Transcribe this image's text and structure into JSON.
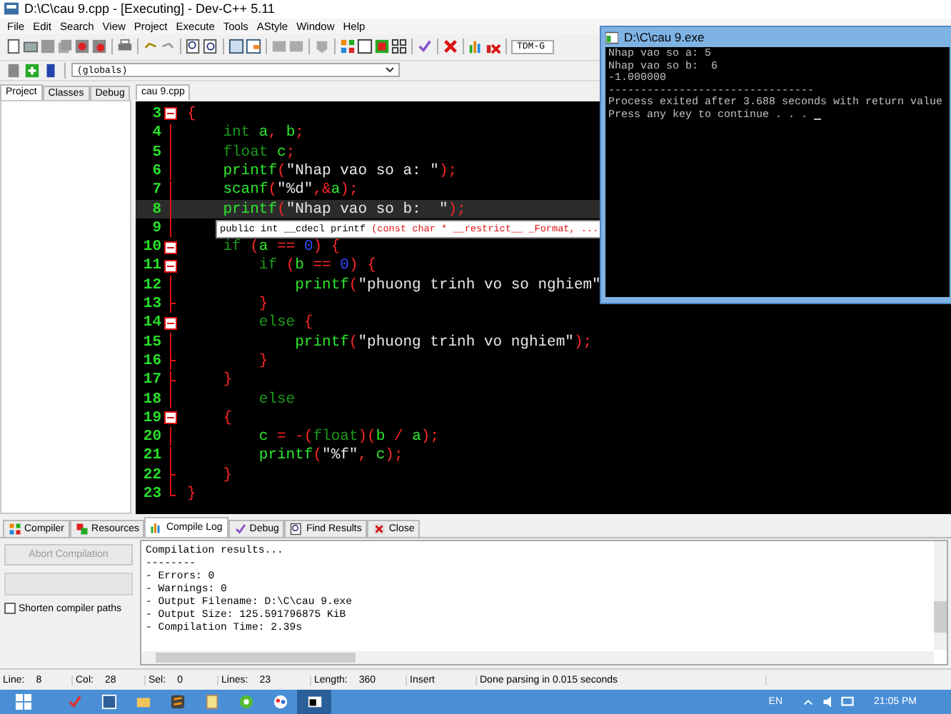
{
  "window": {
    "title": "D:\\C\\cau 9.cpp - [Executing] - Dev-C++ 5.11"
  },
  "menu": [
    "File",
    "Edit",
    "Search",
    "View",
    "Project",
    "Execute",
    "Tools",
    "AStyle",
    "Window",
    "Help"
  ],
  "compiler_select": {
    "value": "TDM-G"
  },
  "scope_select": {
    "value": "(globals)"
  },
  "side_tabs": [
    {
      "label": "Project",
      "selected": true
    },
    {
      "label": "Classes",
      "selected": false
    },
    {
      "label": "Debug",
      "selected": false
    }
  ],
  "editor_tabs": [
    {
      "label": "cau 9.cpp",
      "selected": true
    }
  ],
  "code_lines": [
    {
      "number": "3",
      "kind": "start",
      "current": false,
      "tokens": [
        {
          "text": "{",
          "kind": "punct"
        }
      ]
    },
    {
      "number": "4",
      "kind": "none",
      "current": false,
      "tokens": [
        {
          "text": "    int",
          "kind": "keyword"
        },
        {
          "text": " a",
          "kind": "ident"
        },
        {
          "text": ",",
          "kind": "punct"
        },
        {
          "text": " b",
          "kind": "ident"
        },
        {
          "text": ";",
          "kind": "punct"
        }
      ]
    },
    {
      "number": "5",
      "kind": "none",
      "current": false,
      "tokens": [
        {
          "text": "    float",
          "kind": "keyword"
        },
        {
          "text": " c",
          "kind": "ident"
        },
        {
          "text": ";",
          "kind": "punct"
        }
      ]
    },
    {
      "number": "6",
      "kind": "none",
      "current": false,
      "tokens": [
        {
          "text": "    printf",
          "kind": "ident"
        },
        {
          "text": "(",
          "kind": "punct"
        },
        {
          "text": "\"Nhap vao so a: \"",
          "kind": "string"
        },
        {
          "text": ");",
          "kind": "punct"
        }
      ]
    },
    {
      "number": "7",
      "kind": "none",
      "current": false,
      "tokens": [
        {
          "text": "    scanf",
          "kind": "ident"
        },
        {
          "text": "(",
          "kind": "punct"
        },
        {
          "text": "\"%d\"",
          "kind": "string"
        },
        {
          "text": ",&",
          "kind": "punct"
        },
        {
          "text": "a",
          "kind": "ident"
        },
        {
          "text": ");",
          "kind": "punct"
        }
      ]
    },
    {
      "number": "8",
      "kind": "none",
      "current": true,
      "tokens": [
        {
          "text": "    printf",
          "kind": "ident"
        },
        {
          "text": "(",
          "kind": "punct"
        },
        {
          "text": "\"Nhap vao so b:  \"",
          "kind": "string"
        },
        {
          "text": ");",
          "kind": "punct"
        }
      ]
    },
    {
      "number": "9",
      "kind": "none",
      "current": false
    },
    {
      "number": "10",
      "kind": "start",
      "current": false,
      "tokens": [
        {
          "text": "    if",
          "kind": "keyword"
        },
        {
          "text": " (",
          "kind": "punct"
        },
        {
          "text": "a",
          "kind": "ident"
        },
        {
          "text": " == ",
          "kind": "punct"
        },
        {
          "text": "0",
          "kind": "number"
        },
        {
          "text": ") {",
          "kind": "punct"
        }
      ]
    },
    {
      "number": "11",
      "kind": "start",
      "current": false,
      "tokens": [
        {
          "text": "        if",
          "kind": "keyword"
        },
        {
          "text": " (",
          "kind": "punct"
        },
        {
          "text": "b",
          "kind": "ident"
        },
        {
          "text": " == ",
          "kind": "punct"
        },
        {
          "text": "0",
          "kind": "number"
        },
        {
          "text": ") {",
          "kind": "punct"
        }
      ]
    },
    {
      "number": "12",
      "kind": "none",
      "current": false,
      "tokens": [
        {
          "text": "            printf",
          "kind": "ident"
        },
        {
          "text": "(",
          "kind": "punct"
        },
        {
          "text": "\"phuong trinh vo so nghiem\"",
          "kind": "string"
        }
      ]
    },
    {
      "number": "13",
      "kind": "end",
      "current": false,
      "tokens": [
        {
          "text": "        }",
          "kind": "punct"
        }
      ]
    },
    {
      "number": "14",
      "kind": "start",
      "current": false,
      "tokens": [
        {
          "text": "        else",
          "kind": "keyword"
        },
        {
          "text": " {",
          "kind": "punct"
        }
      ]
    },
    {
      "number": "15",
      "kind": "none",
      "current": false,
      "tokens": [
        {
          "text": "            printf",
          "kind": "ident"
        },
        {
          "text": "(",
          "kind": "punct"
        },
        {
          "text": "\"phuong trinh vo nghiem\"",
          "kind": "string"
        },
        {
          "text": ");",
          "kind": "punct"
        }
      ]
    },
    {
      "number": "16",
      "kind": "end",
      "current": false,
      "tokens": [
        {
          "text": "        }",
          "kind": "punct"
        }
      ]
    },
    {
      "number": "17",
      "kind": "end",
      "current": false,
      "tokens": [
        {
          "text": "    }",
          "kind": "punct"
        }
      ]
    },
    {
      "number": "18",
      "kind": "none",
      "current": false,
      "tokens": [
        {
          "text": "        else",
          "kind": "keyword"
        }
      ]
    },
    {
      "number": "19",
      "kind": "start",
      "current": false,
      "tokens": [
        {
          "text": "    {",
          "kind": "punct"
        }
      ]
    },
    {
      "number": "20",
      "kind": "none",
      "current": false,
      "tokens": [
        {
          "text": "        c",
          "kind": "ident"
        },
        {
          "text": " = -(",
          "kind": "punct"
        },
        {
          "text": "float",
          "kind": "keyword"
        },
        {
          "text": ")(",
          "kind": "punct"
        },
        {
          "text": "b",
          "kind": "ident"
        },
        {
          "text": " / ",
          "kind": "punct"
        },
        {
          "text": "a",
          "kind": "ident"
        },
        {
          "text": ");",
          "kind": "punct"
        }
      ]
    },
    {
      "number": "21",
      "kind": "none",
      "current": false,
      "tokens": [
        {
          "text": "        printf",
          "kind": "ident"
        },
        {
          "text": "(",
          "kind": "punct"
        },
        {
          "text": "\"%f\"",
          "kind": "string"
        },
        {
          "text": ", ",
          "kind": "punct"
        },
        {
          "text": "c",
          "kind": "ident"
        },
        {
          "text": ");",
          "kind": "punct"
        }
      ]
    },
    {
      "number": "22",
      "kind": "end",
      "current": false,
      "tokens": [
        {
          "text": "    }",
          "kind": "punct"
        }
      ]
    },
    {
      "number": "23",
      "kind": "last",
      "current": false,
      "tokens": [
        {
          "text": "}",
          "kind": "punct"
        }
      ]
    }
  ],
  "tooltip": {
    "tokens": [
      {
        "text": "public int __cdecl printf ",
        "kind": "plain"
      },
      {
        "text": "(const char * __restrict__ _Format, ...",
        "kind": "param"
      }
    ]
  },
  "console": {
    "title": "D:\\C\\cau 9.exe",
    "lines": [
      "Nhap vao so a: 5",
      "Nhap vao so b:  6",
      "-1.000000",
      "--------------------------------",
      "Process exited after 3.688 seconds with return value",
      "Press any key to continue . . . "
    ]
  },
  "bottom_tabs": [
    {
      "label": "Compiler",
      "selected": false
    },
    {
      "label": "Resources",
      "selected": false
    },
    {
      "label": "Compile Log",
      "selected": true
    },
    {
      "label": "Debug",
      "selected": false
    },
    {
      "label": "Find Results",
      "selected": false
    },
    {
      "label": "Close",
      "selected": false
    }
  ],
  "abort_button": {
    "label": "Abort Compilation",
    "disabled": true
  },
  "shorten_paths": {
    "label": "Shorten compiler paths",
    "checked": false
  },
  "log_lines": [
    "Compilation results...",
    "--------",
    "- Errors: 0",
    "- Warnings: 0",
    "- Output Filename: D:\\C\\cau 9.exe",
    "- Output Size: 125.591796875 KiB",
    "- Compilation Time: 2.39s"
  ],
  "status_bar": [
    {
      "label": "Line:",
      "value": "8"
    },
    {
      "label": "Col:",
      "value": "28"
    },
    {
      "label": "Sel:",
      "value": "0"
    },
    {
      "label": "Lines:",
      "value": "23"
    },
    {
      "label": "Length:",
      "value": "360"
    }
  ],
  "status_mode": "Insert",
  "status_message": "Done parsing in 0.015 seconds",
  "taskbar": {
    "language": "EN",
    "clock": "21:05 PM"
  }
}
